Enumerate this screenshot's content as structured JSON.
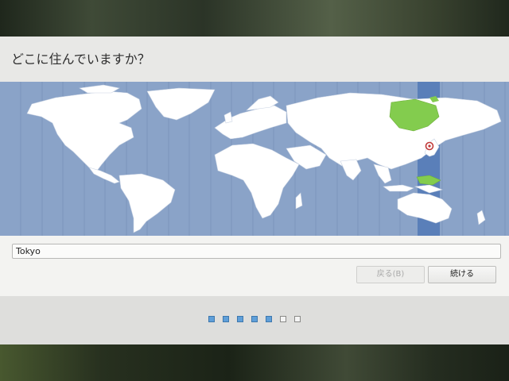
{
  "window": {
    "title": "どこに住んでいますか？"
  },
  "location": {
    "input_value": "Tokyo",
    "selected_city": "Tokyo",
    "selected_zone_color": "#83cc4e",
    "highlight_color": "#5a7fb9"
  },
  "buttons": {
    "back_label": "戻る(B)",
    "back_enabled": false,
    "next_label": "続ける"
  },
  "progress": {
    "total_steps": 7,
    "current_step": 5
  },
  "colors": {
    "ocean": "#8aa3c8",
    "land": "#ffffff",
    "active_step": "#5f9fd9"
  }
}
